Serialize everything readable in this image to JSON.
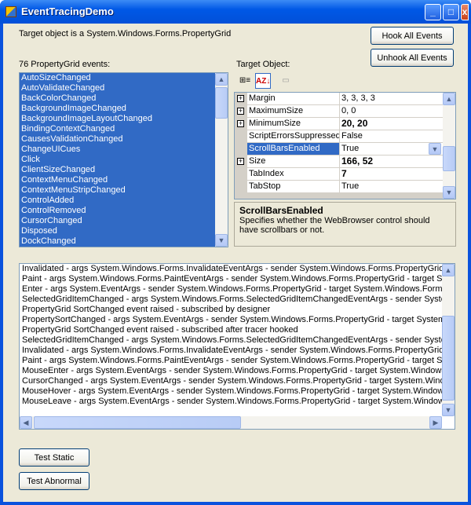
{
  "window": {
    "title": "EventTracingDemo",
    "min": "_",
    "max": "□",
    "close": "x"
  },
  "target_label": "Target object is a System.Windows.Forms.PropertyGrid",
  "buttons": {
    "hook": "Hook All Events",
    "unhook": "Unhook All Events",
    "test_static": "Test Static",
    "test_abnormal": "Test Abnormal"
  },
  "events_label": "76 PropertyGrid events:",
  "events": [
    "AutoSizeChanged",
    "AutoValidateChanged",
    "BackColorChanged",
    "BackgroundImageChanged",
    "BackgroundImageLayoutChanged",
    "BindingContextChanged",
    "CausesValidationChanged",
    "ChangeUICues",
    "Click",
    "ClientSizeChanged",
    "ContextMenuChanged",
    "ContextMenuStripChanged",
    "ControlAdded",
    "ControlRemoved",
    "CursorChanged",
    "Disposed",
    "DockChanged"
  ],
  "target_object_label": "Target Object:",
  "property_grid": {
    "rows": [
      {
        "name": "Margin",
        "value": "3, 3, 3, 3",
        "expandable": true,
        "bold": false
      },
      {
        "name": "MaximumSize",
        "value": "0, 0",
        "expandable": true,
        "bold": false
      },
      {
        "name": "MinimumSize",
        "value": "20, 20",
        "expandable": true,
        "bold": true
      },
      {
        "name": "ScriptErrorsSuppressed",
        "value": "False",
        "expandable": false,
        "bold": false
      },
      {
        "name": "ScrollBarsEnabled",
        "value": "True",
        "expandable": false,
        "bold": false,
        "selected": true
      },
      {
        "name": "Size",
        "value": "166, 52",
        "expandable": true,
        "bold": true
      },
      {
        "name": "TabIndex",
        "value": "7",
        "expandable": false,
        "bold": true
      },
      {
        "name": "TabStop",
        "value": "True",
        "expandable": false,
        "bold": false
      }
    ],
    "description_title": "ScrollBarsEnabled",
    "description_text": "Specifies whether the WebBrowser control should have scrollbars or not."
  },
  "log": [
    "Invalidated - args System.Windows.Forms.InvalidateEventArgs - sender System.Windows.Forms.PropertyGrid - target System.Windows.Forms.PropertyGrid",
    "Paint - args System.Windows.Forms.PaintEventArgs - sender System.Windows.Forms.PropertyGrid - target System.Windows.Forms.PropertyGrid",
    "Enter - args System.EventArgs - sender System.Windows.Forms.PropertyGrid - target System.Windows.Forms.PropertyGrid",
    "SelectedGridItemChanged - args System.Windows.Forms.SelectedGridItemChangedEventArgs - sender System.Windows.Forms.PropertyGrid",
    "PropertyGrid SortChanged event raised - subscribed by designer",
    "PropertySortChanged - args System.EventArgs - sender System.Windows.Forms.PropertyGrid - target System.Windows.Forms.PropertyGrid",
    "PropertyGrid SortChanged event raised - subscribed after tracer hooked",
    "SelectedGridItemChanged - args System.Windows.Forms.SelectedGridItemChangedEventArgs - sender System.Windows.Forms.PropertyGrid",
    "Invalidated - args System.Windows.Forms.InvalidateEventArgs - sender System.Windows.Forms.PropertyGrid - target System.Windows.Forms.PropertyGrid",
    "Paint - args System.Windows.Forms.PaintEventArgs - sender System.Windows.Forms.PropertyGrid - target System.Windows.Forms.PropertyGrid",
    "MouseEnter - args System.EventArgs - sender System.Windows.Forms.PropertyGrid - target System.Windows.Forms.PropertyGrid",
    "CursorChanged - args System.EventArgs - sender System.Windows.Forms.PropertyGrid - target System.Windows.Forms.PropertyGrid",
    "MouseHover - args System.EventArgs - sender System.Windows.Forms.PropertyGrid - target System.Windows.Forms.PropertyGrid",
    "MouseLeave - args System.EventArgs - sender System.Windows.Forms.PropertyGrid - target System.Windows.Forms.PropertyGrid"
  ],
  "colors": {
    "selection": "#316ac5",
    "titlebar": "#0058e6",
    "face": "#ece9d8"
  }
}
